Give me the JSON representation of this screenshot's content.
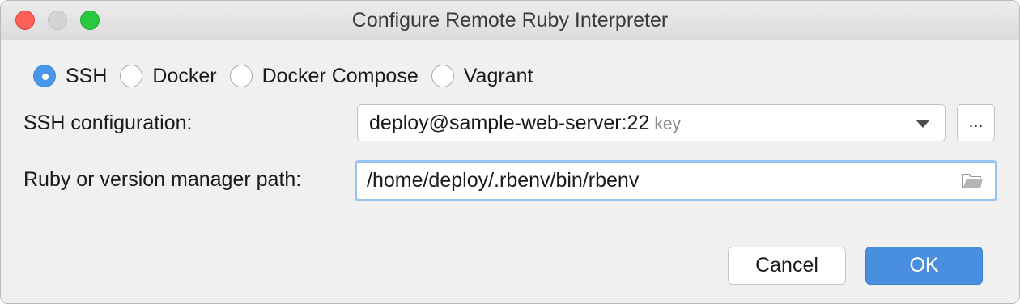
{
  "window": {
    "title": "Configure Remote Ruby Interpreter"
  },
  "connection_types": [
    {
      "label": "SSH",
      "selected": true
    },
    {
      "label": "Docker",
      "selected": false
    },
    {
      "label": "Docker Compose",
      "selected": false
    },
    {
      "label": "Vagrant",
      "selected": false
    }
  ],
  "ssh_configuration": {
    "label": "SSH configuration:",
    "value": "deploy@sample-web-server:22",
    "hint": "key",
    "browse_label": "..."
  },
  "ruby_path": {
    "label": "Ruby or version manager path:",
    "value": "/home/deploy/.rbenv/bin/rbenv",
    "icon": "folder-icon"
  },
  "buttons": {
    "cancel_label": "Cancel",
    "ok_label": "OK"
  },
  "colors": {
    "accent": "#4a8ee0",
    "focus_ring": "#99c3f0",
    "close": "#fe5f57",
    "minimize": "#d4d4d4",
    "maximize": "#28c840"
  }
}
